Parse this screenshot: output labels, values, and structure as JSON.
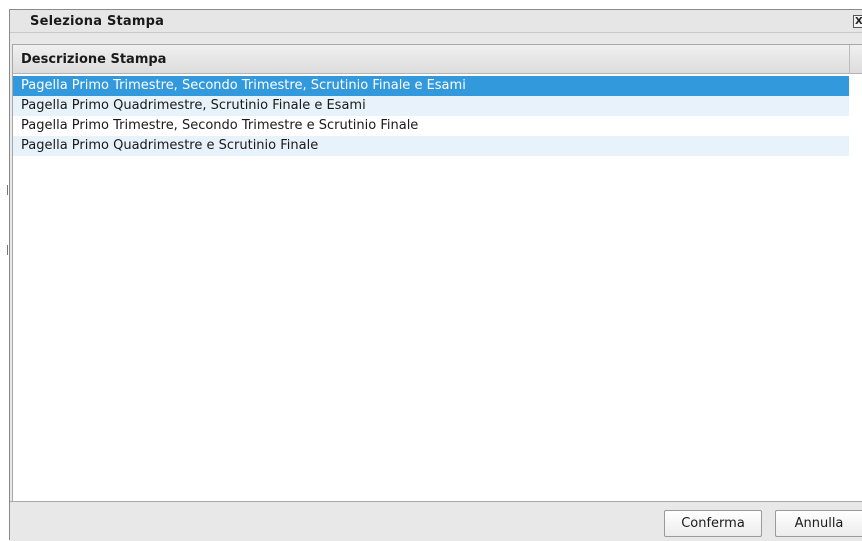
{
  "dialog": {
    "title": "Seleziona Stampa",
    "close_label": "X"
  },
  "grid": {
    "column_header": "Descrizione Stampa",
    "rows": [
      {
        "label": "Pagella Primo Trimestre, Secondo Trimestre, Scrutinio Finale e Esami",
        "selected": true
      },
      {
        "label": "Pagella Primo Quadrimestre, Scrutinio Finale e Esami",
        "selected": false
      },
      {
        "label": "Pagella Primo Trimestre, Secondo Trimestre e Scrutinio Finale",
        "selected": false
      },
      {
        "label": "Pagella Primo Quadrimestre e Scrutinio Finale",
        "selected": false
      }
    ]
  },
  "footer": {
    "confirm_label": "Conferma",
    "cancel_label": "Annulla"
  },
  "colors": {
    "selected_row": "#3399dd",
    "alt_row": "#e8f2fb",
    "dialog_bg": "#e8e8e8"
  }
}
